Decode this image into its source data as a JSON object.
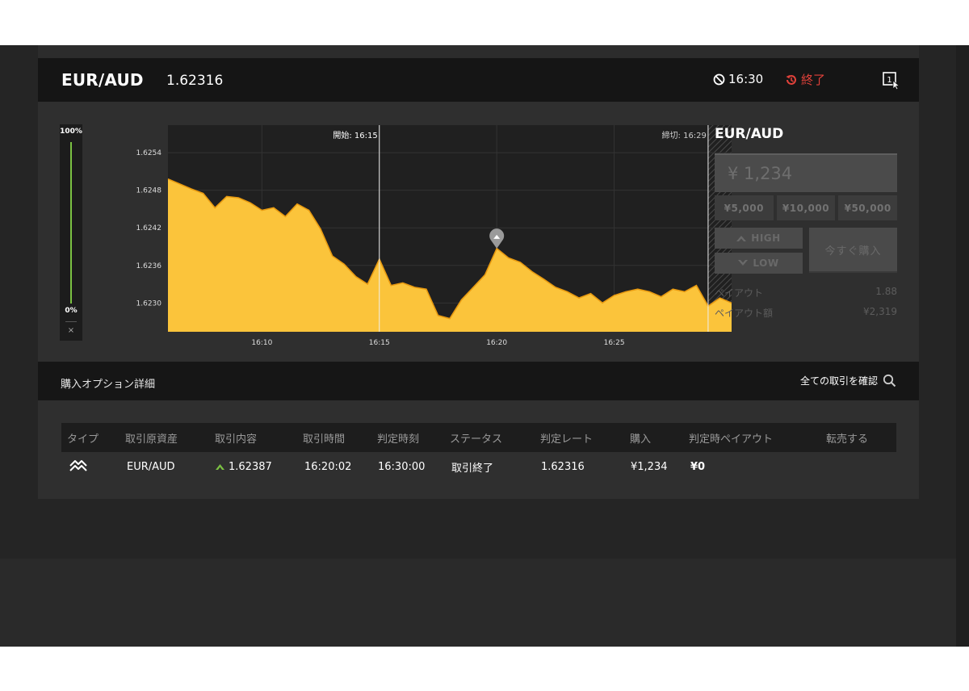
{
  "header": {
    "pair": "EUR/AUD",
    "rate": "1.62316",
    "timer": "16:30",
    "status": "終了"
  },
  "chart_data": {
    "type": "area",
    "yticks": [
      "1.6254",
      "1.6248",
      "1.6242",
      "1.6236",
      "1.6230"
    ],
    "xticks": [
      "16:10",
      "16:15",
      "16:20",
      "16:25"
    ],
    "ylim": [
      1.62254,
      1.62584
    ],
    "start_label": "開始: 16:15",
    "end_label": "締切: 16:29",
    "entry_time": "16:20",
    "entry_value": 1.62387,
    "series": [
      {
        "color": "#f5b82e",
        "points": [
          [
            "16:06:00",
            1.62498
          ],
          [
            "16:06:30",
            1.6249
          ],
          [
            "16:07:00",
            1.62482
          ],
          [
            "16:07:30",
            1.62475
          ],
          [
            "16:08:00",
            1.62452
          ],
          [
            "16:08:30",
            1.6247
          ],
          [
            "16:09:00",
            1.62468
          ],
          [
            "16:09:30",
            1.6246
          ],
          [
            "16:10:00",
            1.62448
          ],
          [
            "16:10:30",
            1.62452
          ],
          [
            "16:11:00",
            1.62438
          ],
          [
            "16:11:30",
            1.62458
          ],
          [
            "16:12:00",
            1.62448
          ],
          [
            "16:12:30",
            1.62418
          ],
          [
            "16:13:00",
            1.62375
          ],
          [
            "16:13:30",
            1.62362
          ],
          [
            "16:14:00",
            1.62342
          ],
          [
            "16:14:30",
            1.6233
          ],
          [
            "16:15:00",
            1.6237
          ],
          [
            "16:15:30",
            1.62328
          ],
          [
            "16:16:00",
            1.62332
          ],
          [
            "16:16:30",
            1.62325
          ],
          [
            "16:17:00",
            1.62322
          ],
          [
            "16:17:30",
            1.6228
          ],
          [
            "16:18:00",
            1.62275
          ],
          [
            "16:18:30",
            1.62305
          ],
          [
            "16:19:00",
            1.62325
          ],
          [
            "16:19:30",
            1.62345
          ],
          [
            "16:20:00",
            1.62387
          ],
          [
            "16:20:30",
            1.62372
          ],
          [
            "16:21:00",
            1.62365
          ],
          [
            "16:21:30",
            1.6235
          ],
          [
            "16:22:00",
            1.62338
          ],
          [
            "16:22:30",
            1.62325
          ],
          [
            "16:23:00",
            1.62318
          ],
          [
            "16:23:30",
            1.62308
          ],
          [
            "16:24:00",
            1.62315
          ],
          [
            "16:24:30",
            1.623
          ],
          [
            "16:25:00",
            1.62312
          ],
          [
            "16:25:30",
            1.62318
          ],
          [
            "16:26:00",
            1.62322
          ],
          [
            "16:26:30",
            1.62318
          ],
          [
            "16:27:00",
            1.6231
          ],
          [
            "16:27:30",
            1.62322
          ],
          [
            "16:28:00",
            1.62318
          ],
          [
            "16:28:30",
            1.62328
          ],
          [
            "16:29:00",
            1.62295
          ],
          [
            "16:29:30",
            1.62308
          ],
          [
            "16:30:00",
            1.623
          ]
        ]
      }
    ],
    "grid": true
  },
  "gauge": {
    "top": "100%",
    "bottom": "0%",
    "close": "×",
    "level": 1.0
  },
  "side": {
    "title": "EUR/AUD",
    "amount": "¥ 1,234",
    "presets": [
      "¥5,000",
      "¥10,000",
      "¥50,000"
    ],
    "high_label": "HIGH",
    "low_label": "LOW",
    "buy_label": "今すぐ購入",
    "payout_label": "ペイアウト",
    "payout_value": "1.88",
    "payout_amount_label": "ペイアウト額",
    "payout_amount_value": "¥2,319"
  },
  "details": {
    "title": "購入オプション詳細",
    "link": "全ての取引を確認"
  },
  "table": {
    "headers": [
      "タイプ",
      "取引原資産",
      "取引内容",
      "取引時間",
      "判定時刻",
      "ステータス",
      "判定レート",
      "購入",
      "判定時ペイアウト",
      "転売する"
    ],
    "rows": [
      {
        "asset": "EUR/AUD",
        "trade": "1.62387",
        "trade_time": "16:20:02",
        "judge_time": "16:30:00",
        "status": "取引終了",
        "judge_rate": "1.62316",
        "purchase": "¥1,234",
        "payout": "¥0",
        "resell": ""
      }
    ]
  },
  "colors": {
    "accent": "#f5b82e",
    "up": "#7bc142",
    "danger": "#e0413a"
  }
}
